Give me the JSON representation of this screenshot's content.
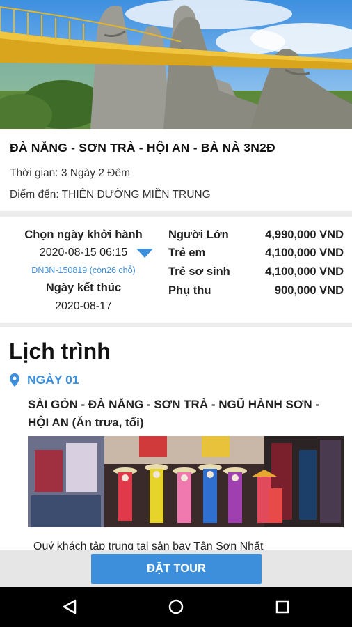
{
  "hero": {
    "image": "golden-bridge-ba-na-hills-photo"
  },
  "tour": {
    "title": "ĐÀ NẴNG - SƠN TRÀ - HỘI AN - BÀ NÀ 3N2Đ",
    "duration": "Thời gian: 3 Ngày 2 Đêm",
    "destination": "Điểm đến: THIÊN ĐƯỜNG MIỀN TRUNG"
  },
  "departure": {
    "label": "Chọn ngày khởi hành",
    "selected": "2020-08-15 06:15",
    "code": "DN3N-150819 (còn26 chỗ)",
    "end_label": "Ngày kết thúc",
    "end_date": "2020-08-17"
  },
  "prices": [
    {
      "label": "Người Lớn",
      "value": "4,990,000 VND"
    },
    {
      "label": "Trẻ em",
      "value": "4,100,000 VND"
    },
    {
      "label": "Trẻ sơ sinh",
      "value": "4,100,000 VND"
    },
    {
      "label": "Phụ thu",
      "value": "900,000 VND"
    }
  ],
  "schedule": {
    "title": "Lịch trình",
    "day_label": "NGÀY 01",
    "day_desc": "SÀI GÒN -  ĐÀ NẴNG - SƠN TRÀ - NGŨ HÀNH SƠN - HỘI AN (Ăn trưa, tối)",
    "photo": "hoi-an-figurines-photo",
    "paragraph": "Quý khách tập trung tại sân bay Tân Sơn Nhất"
  },
  "book_button": "ĐẶT TOUR",
  "colors": {
    "accent": "#3d8fdc",
    "bottom_bar": "#e6e6e6",
    "nav_bar": "#000000"
  },
  "icons": {
    "pin": "location-pin-icon",
    "dropdown": "triangle-down-icon",
    "nav": [
      "back-icon",
      "home-icon",
      "recents-icon"
    ]
  }
}
